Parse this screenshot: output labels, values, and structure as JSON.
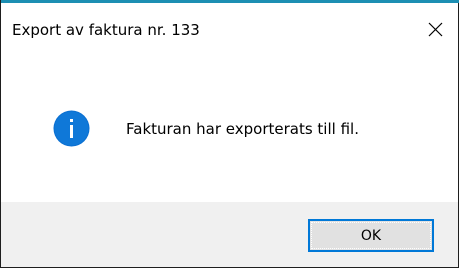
{
  "window": {
    "title": "Export av faktura nr. 133",
    "accent_color": "#1c8fb3"
  },
  "message": {
    "text": "Fakturan har exporterats till fil.",
    "icon": "info-icon",
    "icon_color": "#0078d7"
  },
  "buttons": {
    "ok_label": "OK",
    "focus_color": "#0078d7"
  }
}
